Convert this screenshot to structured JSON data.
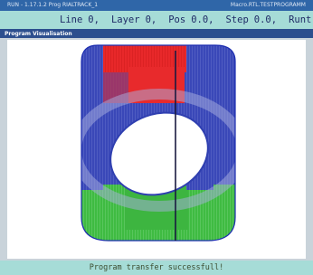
{
  "titlebar": {
    "left": "RUN - 1.17.1.2 Prog RIALTRACK_1",
    "right": "Macro.RTL.TESTPROGRAMM"
  },
  "status": [
    {
      "label": "Line",
      "value": "0,"
    },
    {
      "label": "Layer",
      "value": "0,"
    },
    {
      "label": "Pos",
      "value": "0.0,"
    },
    {
      "label": "Step",
      "value": "0.0,"
    },
    {
      "label": "Runt",
      "value": ""
    }
  ],
  "panel": {
    "title": "Program Visualisation"
  },
  "visualization": {
    "colors": {
      "top": "#e8282a",
      "middle": "#2f3fb0",
      "bottom": "#36b03a",
      "edge": "#1c2db0",
      "axis": "#1a1a40"
    }
  },
  "message": "Program transfer successfull!"
}
